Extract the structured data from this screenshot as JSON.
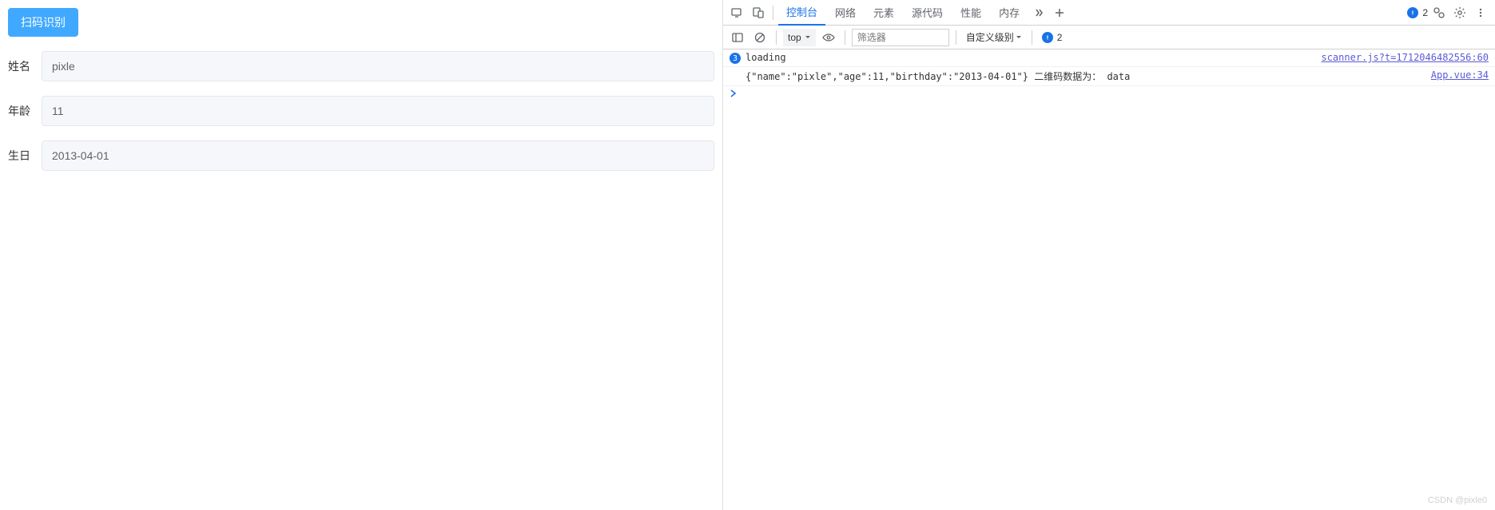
{
  "app": {
    "scan_button": "扫码识别",
    "fields": {
      "name": {
        "label": "姓名",
        "value": "pixle"
      },
      "age": {
        "label": "年龄",
        "value": "11"
      },
      "birthday": {
        "label": "生日",
        "value": "2013-04-01"
      }
    }
  },
  "devtools": {
    "tabs": {
      "console": "控制台",
      "network": "网络",
      "elements": "元素",
      "sources": "源代码",
      "performance": "性能",
      "memory": "内存"
    },
    "active_tab": "控制台",
    "issues_count": "2",
    "toolbar": {
      "context": "top",
      "filter_placeholder": "筛选器",
      "log_level": "自定义级别",
      "hidden_count": "2"
    },
    "console": {
      "rows": [
        {
          "count": "3",
          "text": "loading",
          "source": "scanner.js?t=1712046482556:60"
        },
        {
          "count": "",
          "text": "{\"name\":\"pixle\",\"age\":11,\"birthday\":\"2013-04-01\"} 二维码数据为： data",
          "source": "App.vue:34"
        }
      ]
    }
  },
  "watermark": "CSDN @pixle0"
}
